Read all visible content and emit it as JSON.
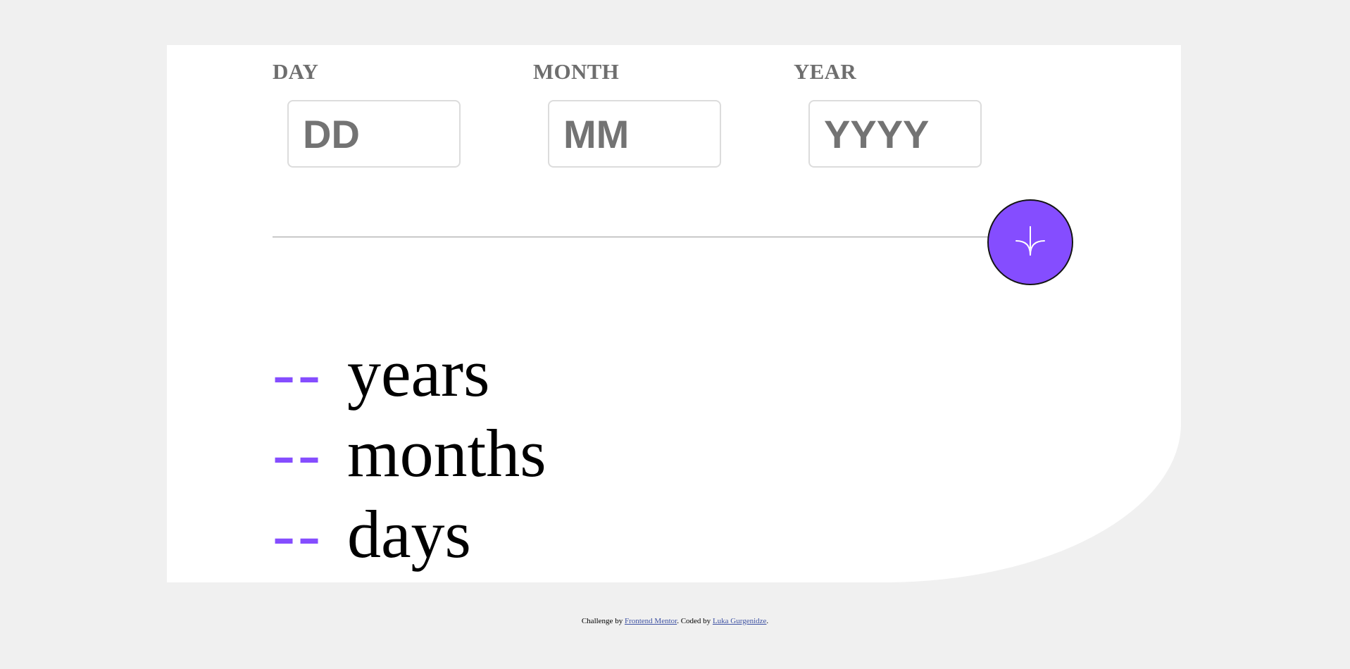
{
  "colors": {
    "accent": "#854dff",
    "label": "#6e6e6e",
    "background": "#f0f0f0",
    "card": "#ffffff",
    "link": "#3e52a3"
  },
  "form": {
    "day": {
      "label": "DAY",
      "placeholder": "DD",
      "value": ""
    },
    "month": {
      "label": "MONTH",
      "placeholder": "MM",
      "value": ""
    },
    "year": {
      "label": "YEAR",
      "placeholder": "YYYY",
      "value": ""
    },
    "submit_icon": "arrow-down-icon"
  },
  "results": {
    "years": {
      "value": "--",
      "unit": "years"
    },
    "months": {
      "value": "--",
      "unit": "months"
    },
    "days": {
      "value": "--",
      "unit": "days"
    }
  },
  "footer": {
    "prefix": "Challenge by ",
    "challenge_link": "Frontend Mentor",
    "middle": ". Coded by ",
    "author_link": "Luka Gurgenidze",
    "suffix": "."
  }
}
